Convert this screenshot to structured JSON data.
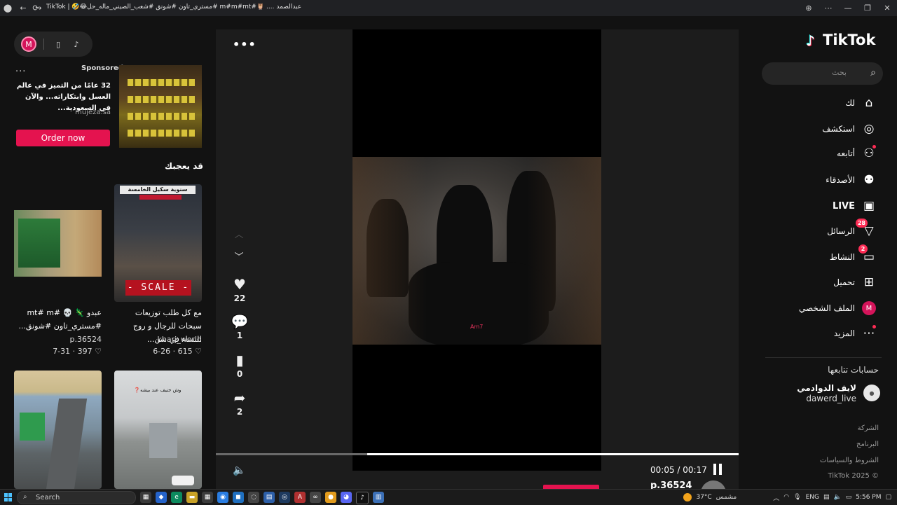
{
  "browser": {
    "title": "TikTok | 🤣😂مستري_تاون #شونق #شعب_الصيني_ماله_حل# m#m#mt#🦉 .... عبدالصمد",
    "back_icon": "arrow-left-icon",
    "forward_icon": "arrow-right-icon",
    "reload_icon": "reload-icon"
  },
  "topbox": {
    "avatar_letter": "M"
  },
  "ad": {
    "menu": "...",
    "sponsored": "Sponsored",
    "text": "32 عامًا من التميز في عالم العسل وابتكاراته... والآن في السعودية...",
    "domain": "mujeza.sa",
    "cta": "Order now"
  },
  "recommend": {
    "title": "قد يعجبك",
    "items": [
      {
        "caption": "عبدو 🦎 💀 #mt# m #مستري_تاون #شونق...",
        "author": "p.36524",
        "meta": "7-31 · 397 ♡"
      },
      {
        "caption": "مع كل طلب توزيعات سبحات للرجال و روج للنساء في سن...",
        "author": "kharj_world",
        "meta": "6-26 · 615 ♡",
        "overlay_title": "سنوية سكيل الخامسة",
        "overlay_scale": "- SCALE -"
      },
      {
        "overlay_caption": "وش جنيف عند بيشه❓"
      }
    ]
  },
  "player": {
    "more": "•••",
    "watermark": "Am7",
    "likes": "22",
    "comments": "1",
    "saves": "0",
    "shares": "2",
    "time": "00:05 / 00:17",
    "progress": 0.29,
    "below_user": "p.36524"
  },
  "sidebar": {
    "logo": "TikTok",
    "search_placeholder": "بحث",
    "nav": [
      {
        "label": "لك",
        "icon": "home-icon"
      },
      {
        "label": "استكشف",
        "icon": "compass-icon"
      },
      {
        "label": "أتابعه",
        "icon": "following-icon"
      },
      {
        "label": "الأصدقاء",
        "icon": "friends-icon"
      },
      {
        "label": "LIVE",
        "icon": "live-icon"
      },
      {
        "label": "الرسائل",
        "icon": "messages-icon",
        "badge": "28"
      },
      {
        "label": "النشاط",
        "icon": "activity-icon",
        "badge": "2"
      },
      {
        "label": "تحميل",
        "icon": "upload-icon"
      },
      {
        "label": "الملف الشخصي",
        "icon": "profile-avatar",
        "avatar": "M"
      },
      {
        "label": "المزيد",
        "icon": "more-icon"
      }
    ],
    "following_title": "حسابات تتابعها",
    "following": [
      {
        "name": "لايف الدوادمي",
        "handle": "dawerd_live"
      }
    ],
    "footer": [
      "الشركة",
      "البرنامج",
      "الشروط والسياسات",
      "TikTok 2025 ©"
    ]
  },
  "taskbar": {
    "search": "Search",
    "weather": "37°C",
    "weather_desc": "مشمس",
    "lang": "ENG",
    "clock": "5:56 PM"
  }
}
